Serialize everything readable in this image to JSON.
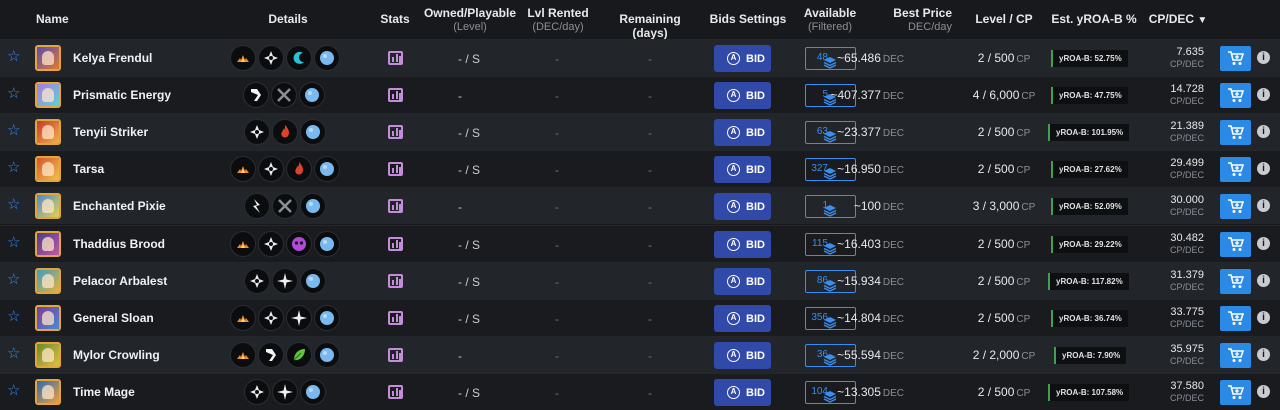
{
  "columns": {
    "name": "Name",
    "details": "Details",
    "stats": "Stats",
    "owned": "Owned/Playable",
    "owned_sub": "(Level)",
    "lvl_rented": "Lvl Rented",
    "lvl_rented_sub": "(DEC/day)",
    "remaining": "Remaining (days)",
    "bids": "Bids Settings",
    "available": "Available",
    "available_sub": "(Filtered)",
    "best_price": "Best Price",
    "best_price_sub": "DEC/day",
    "level_cp": "Level / CP",
    "yroa": "Est. yROA-B %",
    "cpdec": "CP/DEC"
  },
  "units": {
    "dec": "DEC",
    "cp": "CP",
    "cpdec": "CP/DEC",
    "bid": "BID",
    "dash": "-"
  },
  "colors": {
    "accent": "#3a8ef0",
    "bid_button": "#3149a8",
    "cart_button": "#2a8ae5",
    "yroa_bar": "#3fa14f",
    "stats_icon": "#c58cd9"
  },
  "rows": [
    {
      "name": "Kelya Frendul",
      "details": [
        "fire-element-icon",
        "neutral-element-icon",
        "water-splash-icon",
        "mana-orb-icon"
      ],
      "owned": "- / S",
      "rented": "-",
      "remaining": "-",
      "available": "48",
      "price": "~65.486",
      "level": "2 / 500",
      "yroa": "yROA-B: 52.75%",
      "cp": "7.635"
    },
    {
      "name": "Prismatic Energy",
      "details": [
        "arrow-white-icon",
        "crossed-swords-icon",
        "mana-orb-icon"
      ],
      "owned": "-",
      "rented": "-",
      "remaining": "-",
      "available": "5",
      "price": "~407.377",
      "level": "4 / 6,000",
      "yroa": "yROA-B: 47.75%",
      "cp": "14.728"
    },
    {
      "name": "Tenyii Striker",
      "details": [
        "neutral-element-icon",
        "fire-flame-icon",
        "mana-orb-icon"
      ],
      "owned": "- / S",
      "rented": "-",
      "remaining": "-",
      "available": "63",
      "price": "~23.377",
      "level": "2 / 500",
      "yroa": "yROA-B: 101.95%",
      "cp": "21.389"
    },
    {
      "name": "Tarsa",
      "details": [
        "fire-element-icon",
        "neutral-element-icon",
        "fire-flame-icon",
        "mana-orb-icon"
      ],
      "owned": "- / S",
      "rented": "-",
      "remaining": "-",
      "available": "327",
      "price": "~16.950",
      "level": "2 / 500",
      "yroa": "yROA-B: 27.62%",
      "cp": "29.499"
    },
    {
      "name": "Enchanted Pixie",
      "details": [
        "lightning-icon",
        "crossed-swords-icon",
        "mana-orb-icon"
      ],
      "owned": "-",
      "rented": "-",
      "remaining": "-",
      "available": "1",
      "price": "~100",
      "level": "3 / 3,000",
      "yroa": "yROA-B: 52.09%",
      "cp": "30.000"
    },
    {
      "name": "Thaddius Brood",
      "details": [
        "fire-element-icon",
        "neutral-element-icon",
        "death-skull-icon",
        "mana-orb-icon"
      ],
      "owned": "- / S",
      "rented": "-",
      "remaining": "-",
      "available": "115",
      "price": "~16.403",
      "level": "2 / 500",
      "yroa": "yROA-B: 29.22%",
      "cp": "30.482"
    },
    {
      "name": "Pelacor Arbalest",
      "details": [
        "neutral-element-icon",
        "sparkle-icon",
        "mana-orb-icon"
      ],
      "owned": "- / S",
      "rented": "-",
      "remaining": "-",
      "available": "86",
      "price": "~15.934",
      "level": "2 / 500",
      "yroa": "yROA-B: 117.82%",
      "cp": "31.379"
    },
    {
      "name": "General Sloan",
      "details": [
        "fire-element-icon",
        "neutral-element-icon",
        "sparkle-icon",
        "mana-orb-icon"
      ],
      "owned": "- / S",
      "rented": "-",
      "remaining": "-",
      "available": "356",
      "price": "~14.804",
      "level": "2 / 500",
      "yroa": "yROA-B: 36.74%",
      "cp": "33.775"
    },
    {
      "name": "Mylor Crowling",
      "details": [
        "fire-element-icon",
        "arrow-white-icon",
        "earth-leaf-icon",
        "mana-orb-icon"
      ],
      "owned": "-",
      "rented": "-",
      "remaining": "-",
      "available": "36",
      "price": "~55.594",
      "level": "2 / 2,000",
      "yroa": "yROA-B: 7.90%",
      "cp": "35.975"
    },
    {
      "name": "Time Mage",
      "details": [
        "neutral-element-icon",
        "sparkle-icon",
        "mana-orb-icon"
      ],
      "owned": "- / S",
      "rented": "-",
      "remaining": "-",
      "available": "104",
      "price": "~13.305",
      "level": "2 / 500",
      "yroa": "yROA-B: 107.58%",
      "cp": "37.580"
    }
  ]
}
